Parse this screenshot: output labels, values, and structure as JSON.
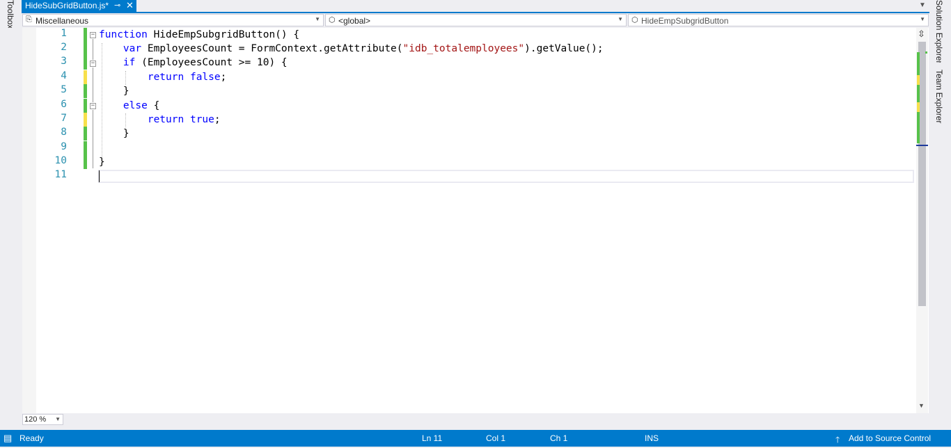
{
  "side_tabs": {
    "toolbox": "Toolbox",
    "solution_explorer": "Solution Explorer",
    "team_explorer": "Team Explorer"
  },
  "document_tab": {
    "title": "HideSubGridButton.js*",
    "pin_icon": "pin-icon",
    "close_icon": "close-icon"
  },
  "nav_bar": {
    "project": "Miscellaneous",
    "scope": "<global>",
    "member": "HideEmpSubgridButton"
  },
  "editor": {
    "line_numbers": [
      "1",
      "2",
      "3",
      "4",
      "5",
      "6",
      "7",
      "8",
      "9",
      "10",
      "11"
    ],
    "code": {
      "l1_kw": "function",
      "l1_rest": " HideEmpSubgridButton() {",
      "l2_kw": "var",
      "l2_a": " EmployeesCount = FormContext.getAttribute(",
      "l2_str": "\"idb_totalemployees\"",
      "l2_b": ").getValue();",
      "l3_kw": "if",
      "l3_rest": " (EmployeesCount >= 10) {",
      "l4_kw": "return",
      "l4_kw2": "false",
      "l4_rest": ";",
      "l5": "}",
      "l6_kw": "else",
      "l6_rest": " {",
      "l7_kw": "return",
      "l7_kw2": "true",
      "l7_rest": ";",
      "l8": "}",
      "l10": "}"
    },
    "change_markers": [
      "saved",
      "saved",
      "saved",
      "unsaved",
      "saved",
      "saved",
      "unsaved",
      "saved",
      "saved",
      "saved"
    ],
    "colors": {
      "keyword": "#0000ff",
      "string": "#a31515",
      "line_number": "#2b91af",
      "saved": "#57c24a",
      "unsaved": "#f7e04b"
    }
  },
  "zoom": {
    "value": "120 %"
  },
  "status_bar": {
    "state": "Ready",
    "line": "Ln 11",
    "col": "Col 1",
    "ch": "Ch 1",
    "mode": "INS",
    "source_control": "Add to Source Control",
    "accent": "#007acc"
  }
}
